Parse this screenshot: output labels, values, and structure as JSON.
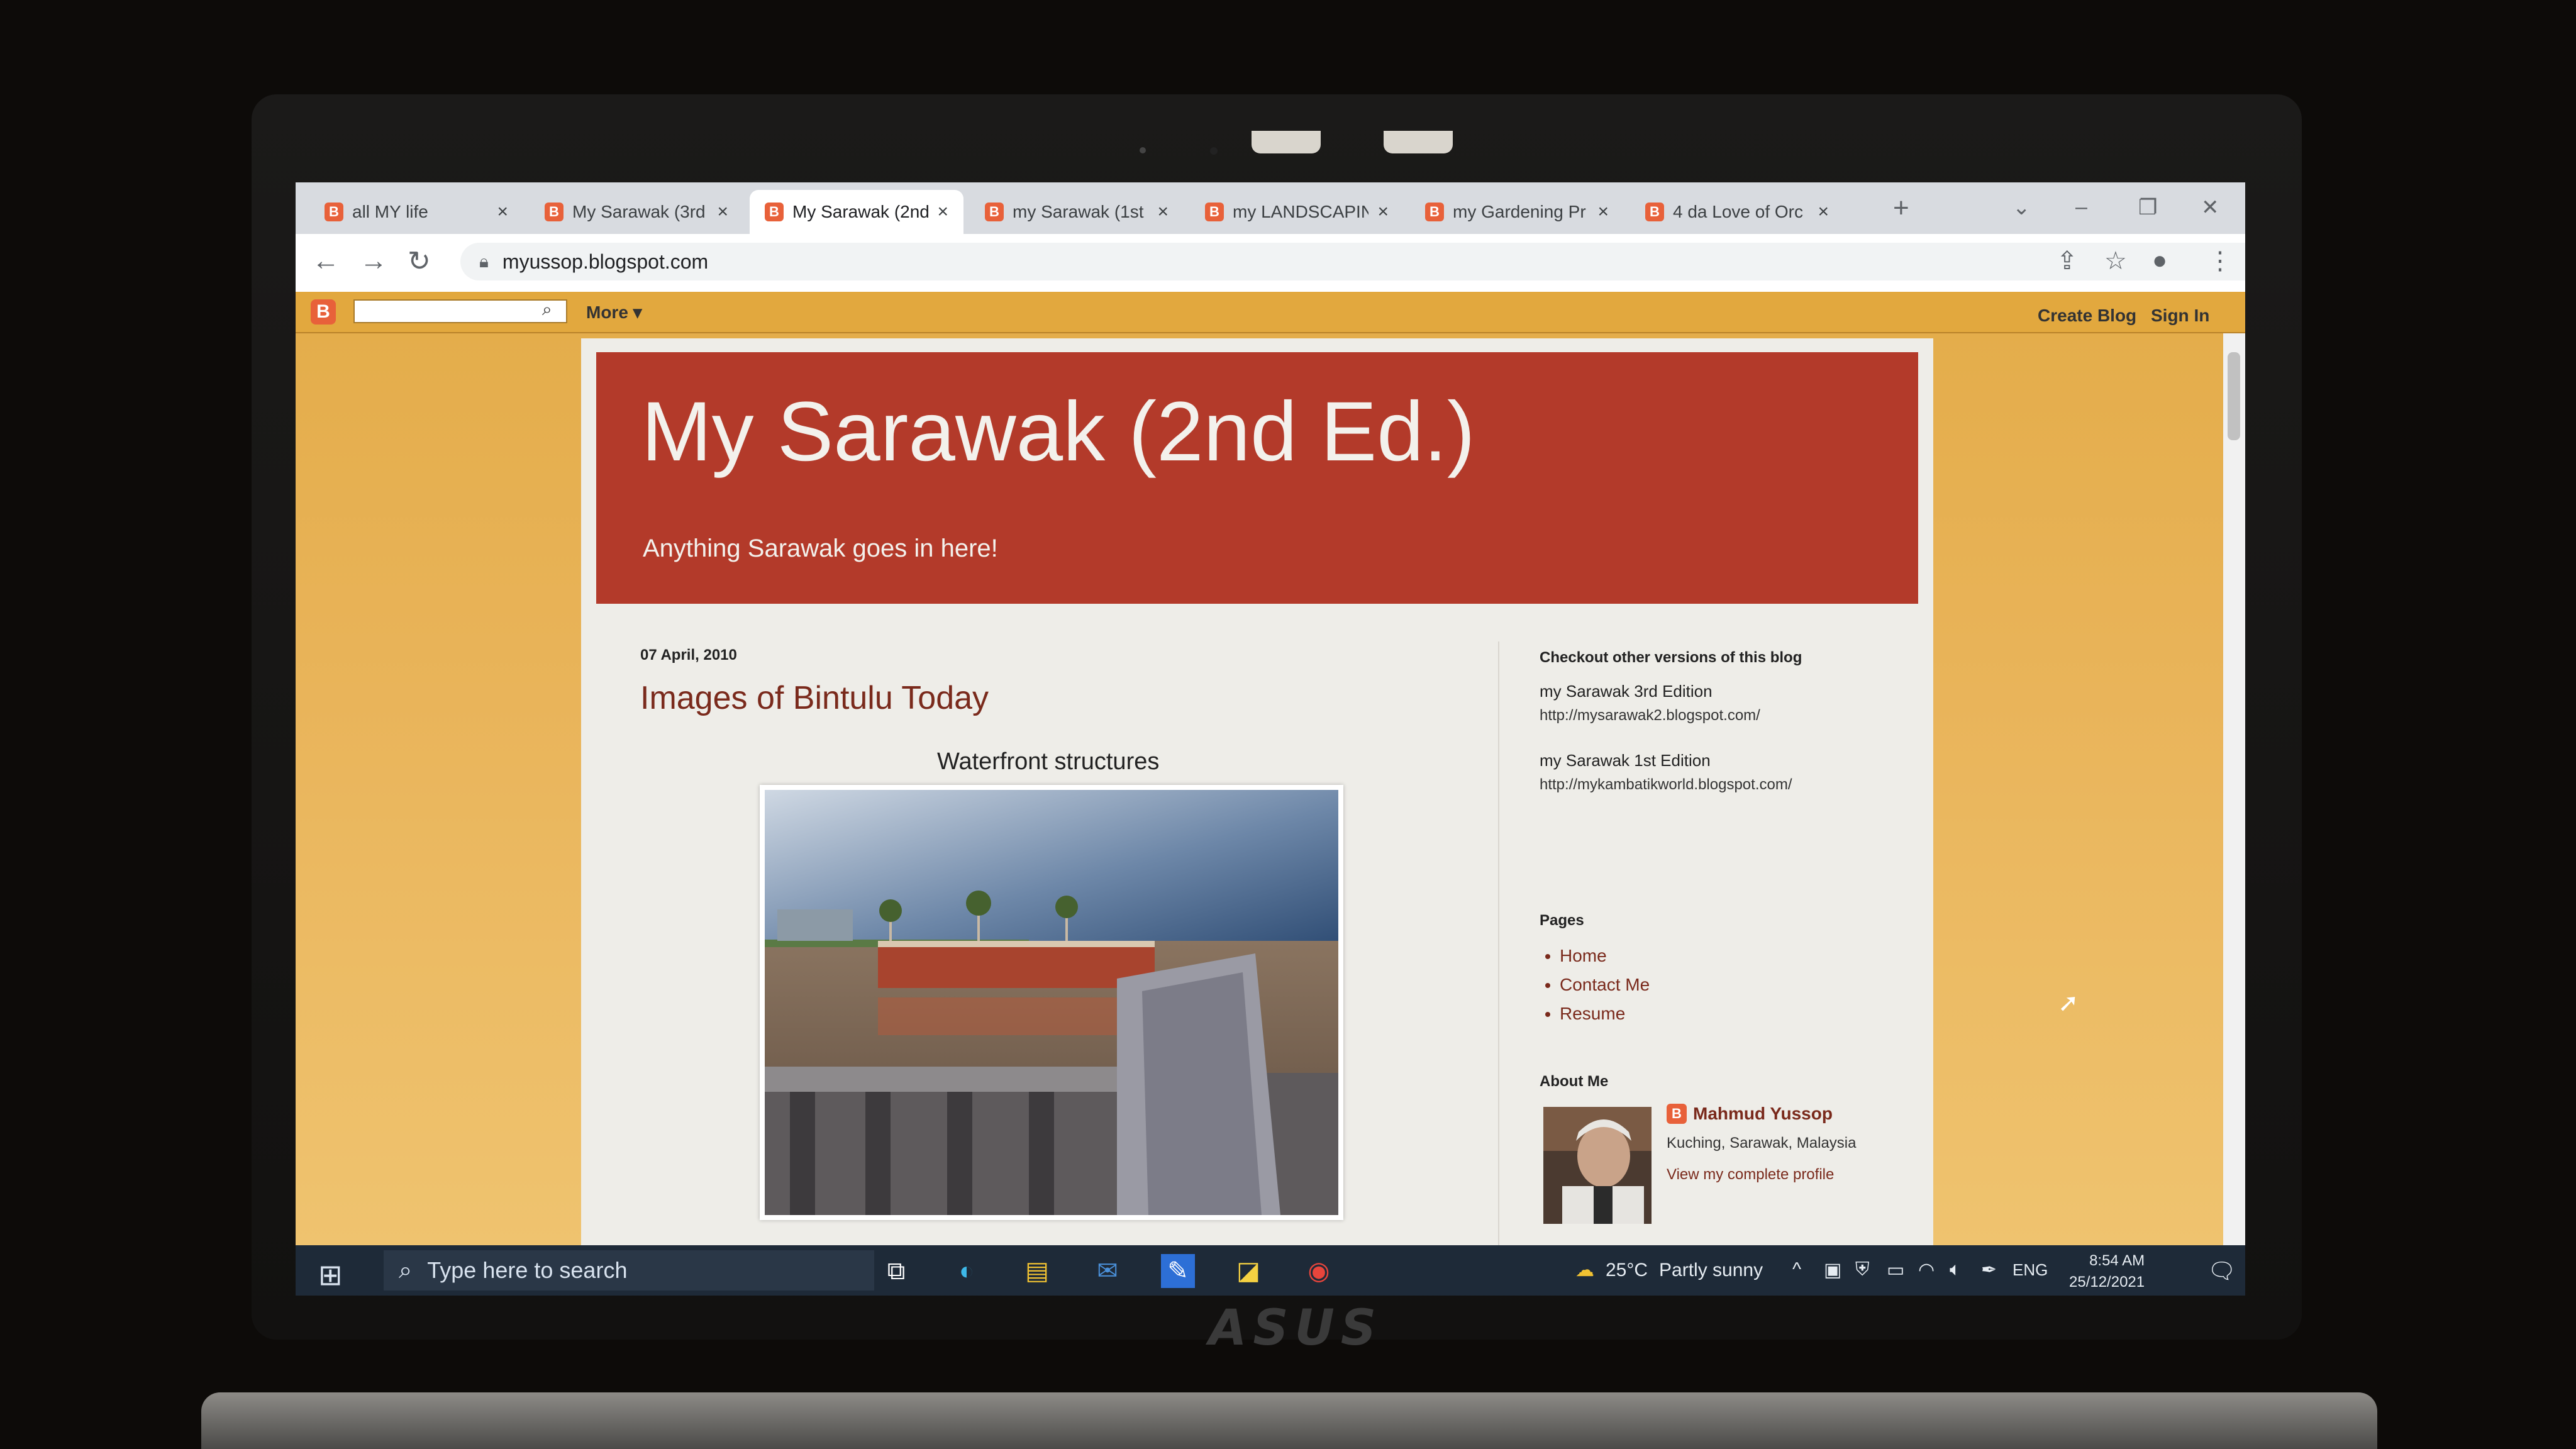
{
  "browser": {
    "tabs": [
      {
        "label": "all MY life",
        "favicon": "B"
      },
      {
        "label": "My Sarawak (3rd",
        "favicon": "B"
      },
      {
        "label": "My Sarawak (2nd",
        "favicon": "B",
        "active": true
      },
      {
        "label": "my Sarawak (1st",
        "favicon": "B"
      },
      {
        "label": "my LANDSCAPIN",
        "favicon": "B"
      },
      {
        "label": "my Gardening Pr",
        "favicon": "B"
      },
      {
        "label": "4 da Love of Orc",
        "favicon": "B"
      }
    ],
    "close_glyph": "×",
    "new_tab_glyph": "+",
    "url": "myussop.blogspot.com"
  },
  "blogger_nav": {
    "logo": "B",
    "more": "More ▾",
    "create_blog": "Create Blog",
    "sign_in": "Sign In"
  },
  "blog": {
    "title": "My Sarawak (2nd Ed.)",
    "description": "Anything Sarawak goes in here!",
    "colors": {
      "header": "#b33a2a",
      "background": "#e4ad4b",
      "link": "#7a2a1c"
    }
  },
  "post": {
    "date": "07 April, 2010",
    "title": "Images of Bintulu Today",
    "caption": "Waterfront structures"
  },
  "sidebar": {
    "versions_heading": "Checkout other versions of this blog",
    "versions": [
      {
        "name": "my Sarawak 3rd Edition",
        "url": "http://mysarawak2.blogspot.com/"
      },
      {
        "name": "my Sarawak 1st Edition",
        "url": "http://mykambatikworld.blogspot.com/"
      }
    ],
    "pages_heading": "Pages",
    "pages": [
      "Home",
      "Contact Me",
      "Resume"
    ],
    "about_heading": "About Me",
    "profile_name": "Mahmud Yussop",
    "location": "Kuching, Sarawak, Malaysia",
    "profile_link": "View my complete profile"
  },
  "taskbar": {
    "search_placeholder": "Type here to search",
    "temperature": "25°C",
    "weather": "Partly sunny",
    "language": "ENG",
    "time": "8:54 AM",
    "date": "25/12/2021"
  },
  "laptop_brand": "ASUS"
}
